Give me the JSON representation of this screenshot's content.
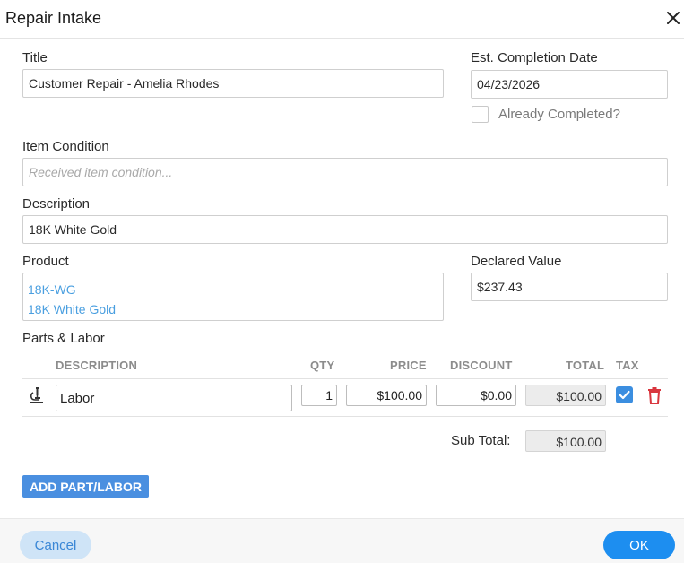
{
  "dialog": {
    "title": "Repair Intake",
    "close_icon": "close-x-icon"
  },
  "form": {
    "title_label": "Title",
    "title_value": "Customer Repair - Amelia Rhodes",
    "completion_label": "Est. Completion Date",
    "completion_value": "04/23/2026",
    "already_completed_label": "Already Completed?",
    "already_completed_checked": false,
    "condition_label": "Item Condition",
    "condition_value": "",
    "condition_placeholder": "Received item condition...",
    "description_label": "Description",
    "description_value": "18K White Gold",
    "product_label": "Product",
    "product_lines": [
      "18K-WG",
      "18K White Gold"
    ],
    "declared_label": "Declared Value",
    "declared_value": "$237.43"
  },
  "parts": {
    "section_label": "Parts & Labor",
    "columns": {
      "description": "DESCRIPTION",
      "qty": "QTY",
      "price": "PRICE",
      "discount": "DISCOUNT",
      "total": "TOTAL",
      "tax": "TAX"
    },
    "rows": [
      {
        "icon": "microscope-icon",
        "description": "Labor",
        "qty": "1",
        "price": "$100.00",
        "discount": "$0.00",
        "total": "$100.00",
        "tax_checked": true,
        "delete_icon": "trash-icon"
      }
    ],
    "subtotal_label": "Sub Total:",
    "subtotal_value": "$100.00",
    "add_button": "ADD PART/LABOR"
  },
  "footer": {
    "cancel_label": "Cancel",
    "ok_label": "OK"
  },
  "colors": {
    "accent": "#1d8ef0",
    "link": "#4a9fe0",
    "add_button": "#4a8fe0",
    "danger": "#d9363e"
  }
}
